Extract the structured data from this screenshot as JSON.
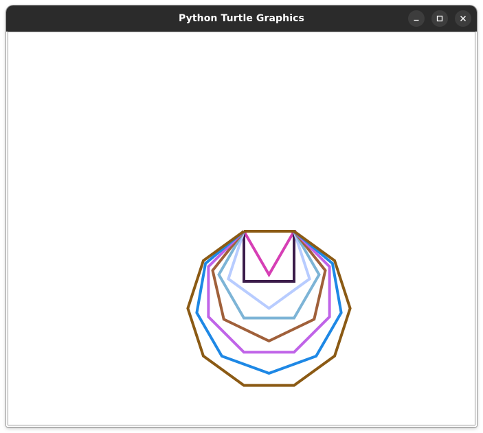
{
  "window": {
    "title": "Python Turtle Graphics"
  },
  "controls": {
    "minimize_icon": "minimize-icon",
    "maximize_icon": "maximize-icon",
    "close_icon": "close-icon"
  },
  "colors": {
    "titlebar": "#2b2b2b",
    "control_bg": "#3d3d3d"
  },
  "drawing": {
    "description_shapes": [
      {
        "sides": 3,
        "color": "#d63fb5"
      },
      {
        "sides": 4,
        "color": "#3b1c4a"
      },
      {
        "sides": 5,
        "color": "#b8ccff"
      },
      {
        "sides": 6,
        "color": "#7db4d6"
      },
      {
        "sides": 7,
        "color": "#a0603a"
      },
      {
        "sides": 8,
        "color": "#c064e8"
      },
      {
        "sides": 9,
        "color": "#1e88e5"
      },
      {
        "sides": 10,
        "color": "#8b5a14"
      }
    ],
    "side_length": 73,
    "line_width": 4
  }
}
